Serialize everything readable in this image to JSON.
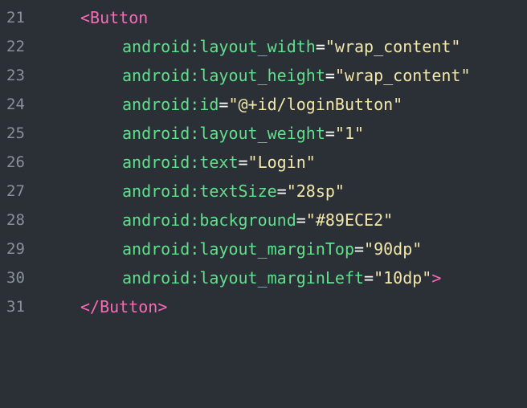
{
  "editor": {
    "colors": {
      "background": "#2b3036",
      "line_number": "#8a9099",
      "tag": "#f76ab8",
      "attribute": "#5fe08a",
      "punctuation": "#ffffff",
      "string": "#f3e7a9"
    },
    "lines": [
      {
        "number": "21",
        "open_tag": "<Button"
      },
      {
        "number": "22",
        "attr": "android:layout_width",
        "eq": "=",
        "value": "\"wrap_content\""
      },
      {
        "number": "23",
        "attr": "android:layout_height",
        "eq": "=",
        "value": "\"wrap_content\""
      },
      {
        "number": "24",
        "attr": "android:id",
        "eq": "=",
        "value": "\"@+id/loginButton\""
      },
      {
        "number": "25",
        "attr": "android:layout_weight",
        "eq": "=",
        "value": "\"1\""
      },
      {
        "number": "26",
        "attr": "android:text",
        "eq": "=",
        "value": "\"Login\""
      },
      {
        "number": "27",
        "attr": "android:textSize",
        "eq": "=",
        "value": "\"28sp\""
      },
      {
        "number": "28",
        "attr": "android:background",
        "eq": "=",
        "value": "\"#89ECE2\""
      },
      {
        "number": "29",
        "attr": "android:layout_marginTop",
        "eq": "=",
        "value": "\"90dp\""
      },
      {
        "number": "30",
        "attr": "android:layout_marginLeft",
        "eq": "=",
        "value": "\"10dp\"",
        "close": ">"
      },
      {
        "number": "31",
        "close_tag": "</Button>"
      }
    ]
  }
}
